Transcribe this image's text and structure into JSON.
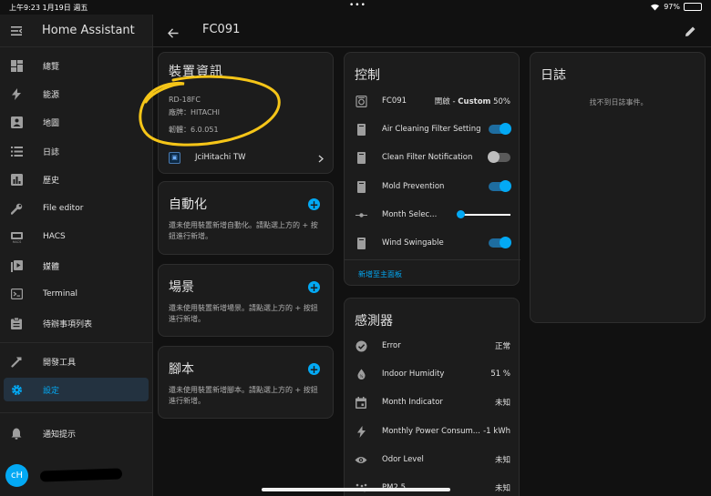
{
  "status": {
    "time": "上午9:23 1月19日 週五",
    "dots": "•••",
    "battery": "97%"
  },
  "app": {
    "title": "Home Assistant"
  },
  "sidebar": {
    "items": [
      {
        "label": "總覽",
        "icon": "dashboard-icon"
      },
      {
        "label": "能源",
        "icon": "lightning-icon"
      },
      {
        "label": "地圖",
        "icon": "map-icon"
      },
      {
        "label": "日誌",
        "icon": "list-icon"
      },
      {
        "label": "歷史",
        "icon": "chart-icon"
      },
      {
        "label": "File editor",
        "icon": "wrench-icon"
      },
      {
        "label": "HACS",
        "icon": "hacs-icon"
      },
      {
        "label": "媒體",
        "icon": "media-icon"
      },
      {
        "label": "Terminal",
        "icon": "terminal-icon"
      },
      {
        "label": "待辦事項列表",
        "icon": "clipboard-icon"
      }
    ],
    "dev_tools": "開發工具",
    "settings": "設定",
    "notifications": "通知提示",
    "avatar": "cH"
  },
  "header": {
    "title": "FC091"
  },
  "device_info": {
    "title": "裝置資訊",
    "model": "RD-18FC",
    "brand": "廠牌：HITACHI",
    "firmware": "韌體：6.0.051",
    "integration": "JciHitachi TW"
  },
  "automation": {
    "title": "自動化",
    "desc": "還未使用裝置新增自動化。請點選上方的 + 按鈕進行新增。"
  },
  "scene": {
    "title": "場景",
    "desc": "還未使用裝置新增場景。請點選上方的 + 按鈕進行新增。"
  },
  "script": {
    "title": "腳本",
    "desc": "還未使用裝置新增腳本。請點選上方的 + 按鈕進行新增。"
  },
  "controls": {
    "title": "控制",
    "rows": [
      {
        "name": "FC091",
        "value_prefix": "開啟 - ",
        "value_bold": "Custom",
        "value_suffix": " 50%"
      },
      {
        "name": "Air Cleaning Filter Setting",
        "state": true
      },
      {
        "name": "Clean Filter Notification",
        "state": false
      },
      {
        "name": "Mold Prevention",
        "state": true
      },
      {
        "name": "Month Selec...",
        "slider": 0
      },
      {
        "name": "Wind Swingable",
        "state": true
      }
    ],
    "add_link": "新增至主面板"
  },
  "sensors": {
    "title": "感測器",
    "rows": [
      {
        "name": "Error",
        "value": "正常"
      },
      {
        "name": "Indoor Humidity",
        "value": "51 %"
      },
      {
        "name": "Month Indicator",
        "value": "未知"
      },
      {
        "name": "Monthly Power Consum...",
        "value": "-1 kWh"
      },
      {
        "name": "Odor Level",
        "value": "未知"
      },
      {
        "name": "PM2.5",
        "value": "未知"
      }
    ]
  },
  "log": {
    "title": "日誌",
    "empty": "找不到日誌事件。"
  },
  "colors": {
    "accent": "#03a9f4",
    "highlight": "#f5c518",
    "background": "#111111",
    "card": "#1c1c1c"
  }
}
